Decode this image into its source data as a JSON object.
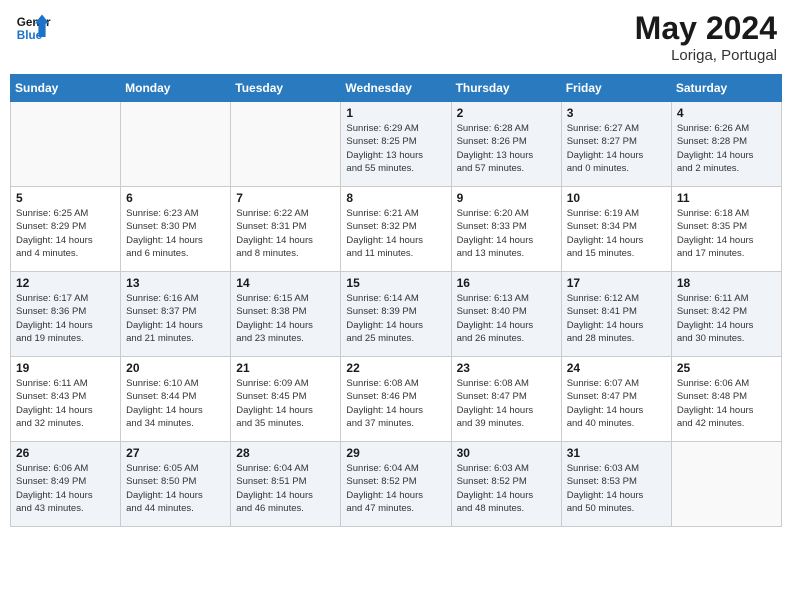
{
  "header": {
    "logo_line1": "General",
    "logo_line2": "Blue",
    "month_year": "May 2024",
    "location": "Loriga, Portugal"
  },
  "weekdays": [
    "Sunday",
    "Monday",
    "Tuesday",
    "Wednesday",
    "Thursday",
    "Friday",
    "Saturday"
  ],
  "weeks": [
    [
      {
        "day": "",
        "info": ""
      },
      {
        "day": "",
        "info": ""
      },
      {
        "day": "",
        "info": ""
      },
      {
        "day": "1",
        "info": "Sunrise: 6:29 AM\nSunset: 8:25 PM\nDaylight: 13 hours\nand 55 minutes."
      },
      {
        "day": "2",
        "info": "Sunrise: 6:28 AM\nSunset: 8:26 PM\nDaylight: 13 hours\nand 57 minutes."
      },
      {
        "day": "3",
        "info": "Sunrise: 6:27 AM\nSunset: 8:27 PM\nDaylight: 14 hours\nand 0 minutes."
      },
      {
        "day": "4",
        "info": "Sunrise: 6:26 AM\nSunset: 8:28 PM\nDaylight: 14 hours\nand 2 minutes."
      }
    ],
    [
      {
        "day": "5",
        "info": "Sunrise: 6:25 AM\nSunset: 8:29 PM\nDaylight: 14 hours\nand 4 minutes."
      },
      {
        "day": "6",
        "info": "Sunrise: 6:23 AM\nSunset: 8:30 PM\nDaylight: 14 hours\nand 6 minutes."
      },
      {
        "day": "7",
        "info": "Sunrise: 6:22 AM\nSunset: 8:31 PM\nDaylight: 14 hours\nand 8 minutes."
      },
      {
        "day": "8",
        "info": "Sunrise: 6:21 AM\nSunset: 8:32 PM\nDaylight: 14 hours\nand 11 minutes."
      },
      {
        "day": "9",
        "info": "Sunrise: 6:20 AM\nSunset: 8:33 PM\nDaylight: 14 hours\nand 13 minutes."
      },
      {
        "day": "10",
        "info": "Sunrise: 6:19 AM\nSunset: 8:34 PM\nDaylight: 14 hours\nand 15 minutes."
      },
      {
        "day": "11",
        "info": "Sunrise: 6:18 AM\nSunset: 8:35 PM\nDaylight: 14 hours\nand 17 minutes."
      }
    ],
    [
      {
        "day": "12",
        "info": "Sunrise: 6:17 AM\nSunset: 8:36 PM\nDaylight: 14 hours\nand 19 minutes."
      },
      {
        "day": "13",
        "info": "Sunrise: 6:16 AM\nSunset: 8:37 PM\nDaylight: 14 hours\nand 21 minutes."
      },
      {
        "day": "14",
        "info": "Sunrise: 6:15 AM\nSunset: 8:38 PM\nDaylight: 14 hours\nand 23 minutes."
      },
      {
        "day": "15",
        "info": "Sunrise: 6:14 AM\nSunset: 8:39 PM\nDaylight: 14 hours\nand 25 minutes."
      },
      {
        "day": "16",
        "info": "Sunrise: 6:13 AM\nSunset: 8:40 PM\nDaylight: 14 hours\nand 26 minutes."
      },
      {
        "day": "17",
        "info": "Sunrise: 6:12 AM\nSunset: 8:41 PM\nDaylight: 14 hours\nand 28 minutes."
      },
      {
        "day": "18",
        "info": "Sunrise: 6:11 AM\nSunset: 8:42 PM\nDaylight: 14 hours\nand 30 minutes."
      }
    ],
    [
      {
        "day": "19",
        "info": "Sunrise: 6:11 AM\nSunset: 8:43 PM\nDaylight: 14 hours\nand 32 minutes."
      },
      {
        "day": "20",
        "info": "Sunrise: 6:10 AM\nSunset: 8:44 PM\nDaylight: 14 hours\nand 34 minutes."
      },
      {
        "day": "21",
        "info": "Sunrise: 6:09 AM\nSunset: 8:45 PM\nDaylight: 14 hours\nand 35 minutes."
      },
      {
        "day": "22",
        "info": "Sunrise: 6:08 AM\nSunset: 8:46 PM\nDaylight: 14 hours\nand 37 minutes."
      },
      {
        "day": "23",
        "info": "Sunrise: 6:08 AM\nSunset: 8:47 PM\nDaylight: 14 hours\nand 39 minutes."
      },
      {
        "day": "24",
        "info": "Sunrise: 6:07 AM\nSunset: 8:47 PM\nDaylight: 14 hours\nand 40 minutes."
      },
      {
        "day": "25",
        "info": "Sunrise: 6:06 AM\nSunset: 8:48 PM\nDaylight: 14 hours\nand 42 minutes."
      }
    ],
    [
      {
        "day": "26",
        "info": "Sunrise: 6:06 AM\nSunset: 8:49 PM\nDaylight: 14 hours\nand 43 minutes."
      },
      {
        "day": "27",
        "info": "Sunrise: 6:05 AM\nSunset: 8:50 PM\nDaylight: 14 hours\nand 44 minutes."
      },
      {
        "day": "28",
        "info": "Sunrise: 6:04 AM\nSunset: 8:51 PM\nDaylight: 14 hours\nand 46 minutes."
      },
      {
        "day": "29",
        "info": "Sunrise: 6:04 AM\nSunset: 8:52 PM\nDaylight: 14 hours\nand 47 minutes."
      },
      {
        "day": "30",
        "info": "Sunrise: 6:03 AM\nSunset: 8:52 PM\nDaylight: 14 hours\nand 48 minutes."
      },
      {
        "day": "31",
        "info": "Sunrise: 6:03 AM\nSunset: 8:53 PM\nDaylight: 14 hours\nand 50 minutes."
      },
      {
        "day": "",
        "info": ""
      }
    ]
  ]
}
